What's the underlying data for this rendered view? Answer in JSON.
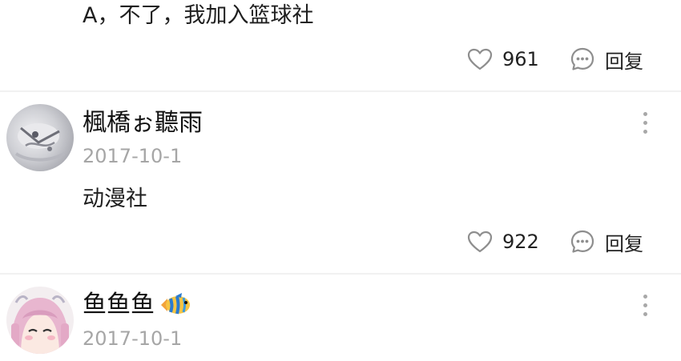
{
  "comment_top": {
    "text": "A，不了，我加入篮球社",
    "likes": "961",
    "reply_label": "回复"
  },
  "comments": [
    {
      "username": "楓橋ぉ聽雨",
      "date": "2017-10-1",
      "text": "动漫社",
      "likes": "922",
      "reply_label": "回复",
      "avatar_icon": "grey-anime-character-avatar"
    },
    {
      "username": "鱼鱼鱼",
      "date": "2017-10-1",
      "avatar_icon": "pink-haired-anime-girl-avatar",
      "name_badge_icon": "tropical-fish-emoji"
    }
  ],
  "colors": {
    "date_grey": "#a6a6a6",
    "icon_grey": "#8e8e8e",
    "divider": "#f1f1f1"
  }
}
